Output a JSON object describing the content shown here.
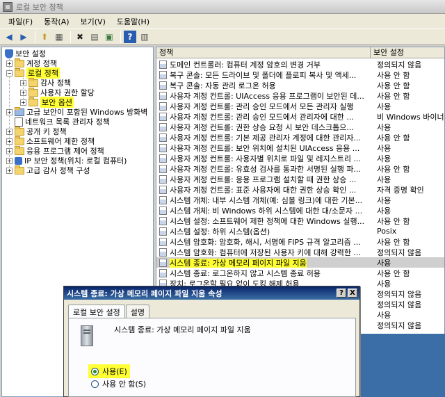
{
  "window": {
    "title": "로컬 보안 정책"
  },
  "menu": [
    "파일(F)",
    "동작(A)",
    "보기(V)",
    "도움말(H)"
  ],
  "toolbar": {
    "icons": [
      "back-arrow-icon",
      "forward-arrow-icon",
      "up-folder-icon",
      "show-hide-tree-icon",
      "delete-icon",
      "properties-icon",
      "export-list-icon",
      "help-icon",
      "console-icon"
    ],
    "glyphs": [
      "◀",
      "▶",
      "⬆",
      "▦",
      "✖",
      "▤",
      "▣",
      "?",
      "▥"
    ]
  },
  "tree": {
    "root": "보안 설정",
    "account_policies": "계정 정책",
    "local_policies": "로컬 정책",
    "audit_policy": "감사 정책",
    "user_rights": "사용자 권한 할당",
    "security_options": "보안 옵션",
    "firewall": "고급 보안이 포함된 Windows 방화벽",
    "network_list": "네트워크 목록 관리자 정책",
    "public_key": "공개 키 정책",
    "software_restriction": "소프트웨어 제한 정책",
    "app_control": "응용 프로그램 제어 정책",
    "ip_security": "IP 보안 정책(위치: 로컬 컴퓨터)",
    "advanced_audit": "고급 감사 정책 구성"
  },
  "list": {
    "col_policy": "정책",
    "col_setting": "보안 설정",
    "rows": [
      {
        "policy": "도메인 컨트롤러: 컴퓨터 계정 암호의 변경 거부",
        "setting": "정의되지 않음"
      },
      {
        "policy": "복구 콘솔: 모든 드라이브 및 폴더에 플로피 복사 및 액세...",
        "setting": "사용 안 함"
      },
      {
        "policy": "복구 콘솔: 자동 관리 로그온 허용",
        "setting": "사용 안 함"
      },
      {
        "policy": "사용자 계정 컨트롤: UIAccess 응용 프로그램이 보안된 데...",
        "setting": "사용 안 함"
      },
      {
        "policy": "사용자 계정 컨트롤: 관리 승인 모드에서 모든 관리자 실행",
        "setting": "사용"
      },
      {
        "policy": "사용자 계정 컨트롤: 관리 승인 모드에서 관리자에 대한 ...",
        "setting": "비 Windows 바이너리"
      },
      {
        "policy": "사용자 계정 컨트롤: 권한 상승 요청 시 보안 데스크톱으...",
        "setting": "사용"
      },
      {
        "policy": "사용자 계정 컨트롤: 기본 제공 관리자 계정에 대한 관리자...",
        "setting": "사용 안 함"
      },
      {
        "policy": "사용자 계정 컨트롤: 보안 위치에 설치된 UIAccess 응용 ...",
        "setting": "사용"
      },
      {
        "policy": "사용자 계정 컨트롤: 사용자별 위치로 파일 및 레지스트리 ...",
        "setting": "사용"
      },
      {
        "policy": "사용자 계정 컨트롤: 유효성 검사를 통과한 서명된 실행 파...",
        "setting": "사용 안 함"
      },
      {
        "policy": "사용자 계정 컨트롤: 응용 프로그램 설치할 때 권한 상승 ...",
        "setting": "사용"
      },
      {
        "policy": "사용자 계정 컨트롤: 표준 사용자에 대한 권한 상승 확인 ...",
        "setting": "자격 증명 확인"
      },
      {
        "policy": "시스템 개체: 내부 시스템 개체(예: 심볼 링크)에 대한 기본...",
        "setting": "사용"
      },
      {
        "policy": "시스템 개체: 비 Windows 하위 시스템에 대한 대/소문자 ...",
        "setting": "사용"
      },
      {
        "policy": "시스템 설정: 소프트웨어 제한 정책에 대한 Windows 실행...",
        "setting": "사용 안 함"
      },
      {
        "policy": "시스템 설정: 하위 시스템(옵션)",
        "setting": "Posix"
      },
      {
        "policy": "시스템 암호화: 암호화, 해시, 서명에 FIPS 규격 알고리즘 ...",
        "setting": "사용 안 함"
      },
      {
        "policy": "시스템 암호화: 컴퓨터에 저장된 사용자 키에 대해 강력한 ...",
        "setting": "정의되지 않음"
      },
      {
        "policy": "시스템 종료: 가상 메모리 페이지 파일 지움",
        "setting": "사용",
        "selected": true
      },
      {
        "policy": "시스템 종료: 로그온하지 않고 시스템 종료 허용",
        "setting": "사용 안 함"
      },
      {
        "policy": "장치: 로그온할 필요 없이 도킹 해제 허용",
        "setting": "사용"
      },
      {
        "policy": "",
        "setting": "정의되지 않음"
      },
      {
        "policy": "",
        "setting": "정의되지 않음"
      },
      {
        "policy": "",
        "setting": "사용"
      },
      {
        "policy": "",
        "setting": "정의되지 않음"
      }
    ]
  },
  "dialog": {
    "title": "시스템 종료: 가상 메모리 페이지 파일 지움 속성",
    "help_btn": "?",
    "close_btn": "X",
    "tab_local": "로컬 보안 설정",
    "tab_explain": "설명",
    "description": "시스템 종료: 가상 메모리 페이지 파일 지움",
    "enable_label": "사용(E)",
    "disable_label": "사용 안 함(S)",
    "selected": "enable"
  }
}
